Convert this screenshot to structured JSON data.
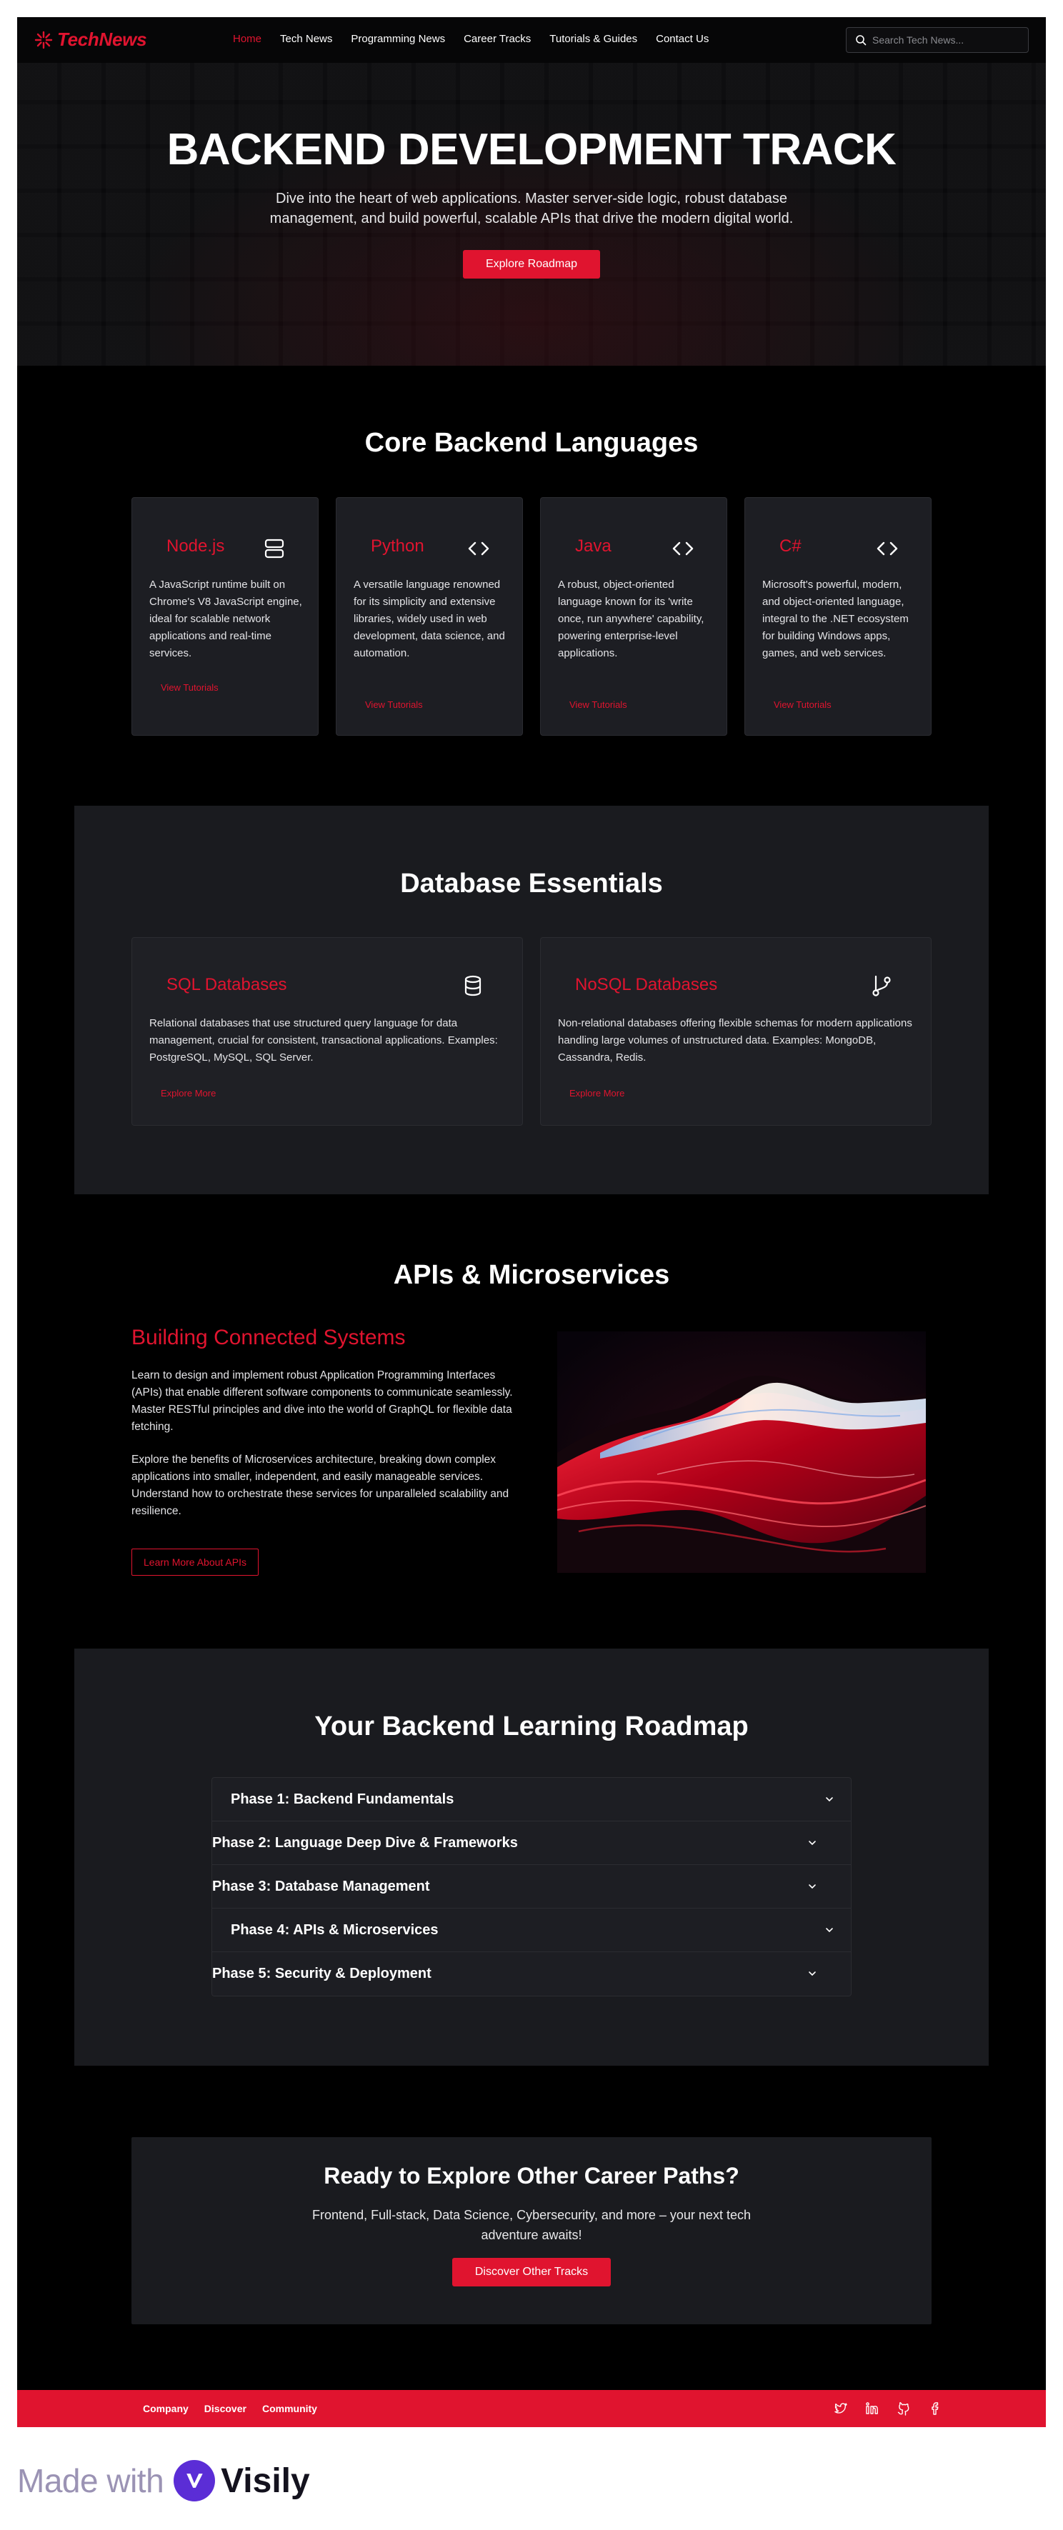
{
  "nav": {
    "logo": "TechNews",
    "links": [
      "Home",
      "Tech News",
      "Programming News",
      "Career Tracks",
      "Tutorials & Guides",
      "Contact Us"
    ],
    "active": "Home",
    "search_placeholder": "Search Tech News..."
  },
  "hero": {
    "title": "BACKEND DEVELOPMENT TRACK",
    "subtitle": "Dive into the heart of web applications. Master server-side logic, robust database management, and build powerful, scalable APIs that drive the modern digital world.",
    "cta": "Explore Roadmap"
  },
  "languages": {
    "title": "Core Backend Languages",
    "cards": [
      {
        "name": "Node.js",
        "icon": "server-icon",
        "description": "A JavaScript runtime built on Chrome's V8 JavaScript engine, ideal for scalable network applications and real-time services.",
        "link": "View Tutorials"
      },
      {
        "name": "Python",
        "icon": "code-icon",
        "description": "A versatile language renowned for its simplicity and extensive libraries, widely used in web development, data science, and automation.",
        "link": "View Tutorials"
      },
      {
        "name": "Java",
        "icon": "code-icon",
        "description": "A robust, object-oriented language known for its 'write once, run anywhere' capability, powering enterprise-level applications.",
        "link": "View Tutorials"
      },
      {
        "name": "C#",
        "icon": "code-icon",
        "description": "Microsoft's powerful, modern, and object-oriented language, integral to the .NET ecosystem for building Windows apps, games, and web services.",
        "link": "View Tutorials"
      }
    ]
  },
  "database": {
    "title": "Database Essentials",
    "cards": [
      {
        "name": "SQL Databases",
        "icon": "database-icon",
        "description": "Relational databases that use structured query language for data management, crucial for consistent, transactional applications. Examples: PostgreSQL, MySQL, SQL Server.",
        "link": "Explore More"
      },
      {
        "name": "NoSQL Databases",
        "icon": "git-branch-icon",
        "description": "Non-relational databases offering flexible schemas for modern applications handling large volumes of unstructured data. Examples: MongoDB, Cassandra, Redis.",
        "link": "Explore More"
      }
    ]
  },
  "apis": {
    "title": "APIs & Microservices",
    "heading": "Building Connected Systems",
    "paragraph1": "Learn to design and implement robust Application Programming Interfaces (APIs) that enable different software components to communicate seamlessly. Master RESTful principles and dive into the world of GraphQL for flexible data fetching.",
    "paragraph2": "Explore the benefits of Microservices architecture, breaking down complex applications into smaller, independent, and easily manageable services. Understand how to orchestrate these services for unparalleled scalability and resilience.",
    "button": "Learn More About APIs"
  },
  "roadmap": {
    "title": "Your Backend Learning Roadmap",
    "phases": [
      "Phase 1: Backend Fundamentals",
      "Phase 2: Language Deep Dive & Frameworks",
      "Phase 3: Database Management",
      "Phase 4: APIs & Microservices",
      "Phase 5: Security & Deployment"
    ]
  },
  "cta": {
    "title": "Ready to Explore Other Career Paths?",
    "text": "Frontend, Full-stack, Data Science, Cybersecurity, and more – your next tech adventure awaits!",
    "button": "Discover Other Tracks"
  },
  "footer": {
    "links": [
      "Company",
      "Discover",
      "Community"
    ],
    "icons": [
      "twitter-icon",
      "linkedin-icon",
      "github-icon",
      "facebook-icon"
    ]
  },
  "badge": {
    "made_with": "Made with",
    "brand": "Visily"
  },
  "colors": {
    "accent": "#e0142f",
    "background": "#000000",
    "card": "#1d1e23",
    "panel": "#1a1b1f"
  }
}
